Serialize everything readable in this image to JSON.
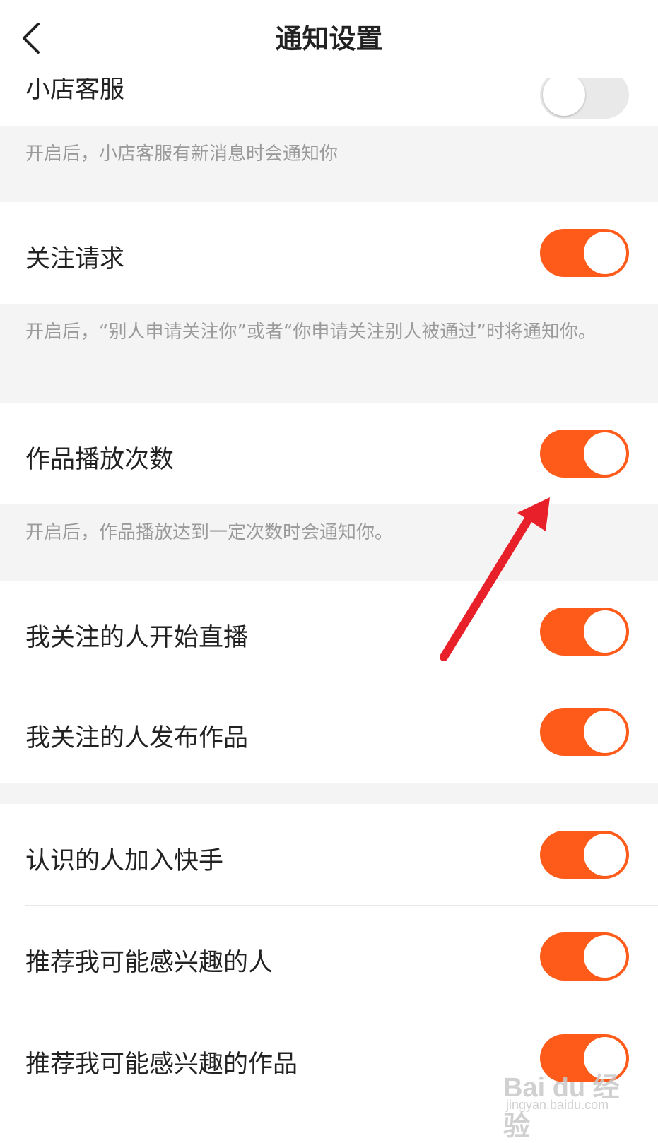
{
  "header": {
    "title": "通知设置"
  },
  "rows": [
    {
      "label": "小店客服",
      "on": false,
      "note": "开启后，小店客服有新消息时会通知你"
    },
    {
      "label": "关注请求",
      "on": true,
      "note": "开启后，“别人申请关注你”或者“你申请关注别人被通过”时将通知你。"
    },
    {
      "label": "作品播放次数",
      "on": true,
      "note": "开启后，作品播放达到一定次数时会通知你。"
    },
    {
      "label": "我关注的人开始直播",
      "on": true
    },
    {
      "label": "我关注的人发布作品",
      "on": true
    },
    {
      "label": "认识的人加入快手",
      "on": true
    },
    {
      "label": "推荐我可能感兴趣的人",
      "on": true
    },
    {
      "label": "推荐我可能感兴趣的作品",
      "on": true
    }
  ],
  "watermark": {
    "brand": "Bai du 经验",
    "url": "jingyan.baidu.com"
  },
  "colors": {
    "accent": "#fe5b1a",
    "annotation_arrow": "#e8202a"
  }
}
